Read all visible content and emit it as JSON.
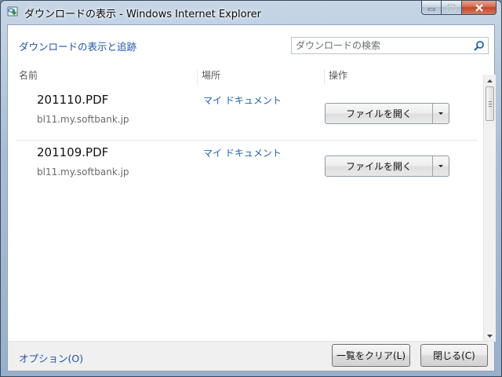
{
  "window": {
    "title": "ダウンロードの表示 - Windows Internet Explorer"
  },
  "header": {
    "link": "ダウンロードの表示と追跡"
  },
  "search": {
    "placeholder": "ダウンロードの検索"
  },
  "columns": {
    "name": "名前",
    "location": "場所",
    "action": "操作"
  },
  "downloads": [
    {
      "filename": "201110.PDF",
      "host": "bl11.my.softbank.jp",
      "location": "マイ ドキュメント",
      "action": "ファイルを開く"
    },
    {
      "filename": "201109.PDF",
      "host": "bl11.my.softbank.jp",
      "location": "マイ ドキュメント",
      "action": "ファイルを開く"
    }
  ],
  "footer": {
    "options": "オプション(O)",
    "clear": "一覧をクリア(L)",
    "close": "閉じる(C)"
  },
  "icons": {
    "app": "ie-download-icon",
    "search": "search-icon",
    "dropdown": "chevron-down-icon",
    "minimize": "minimize-icon",
    "maximize": "maximize-icon",
    "close": "close-icon"
  },
  "colors": {
    "link": "#1f53a8",
    "location_link": "#1f63b0",
    "title_close": "#c3462a"
  }
}
